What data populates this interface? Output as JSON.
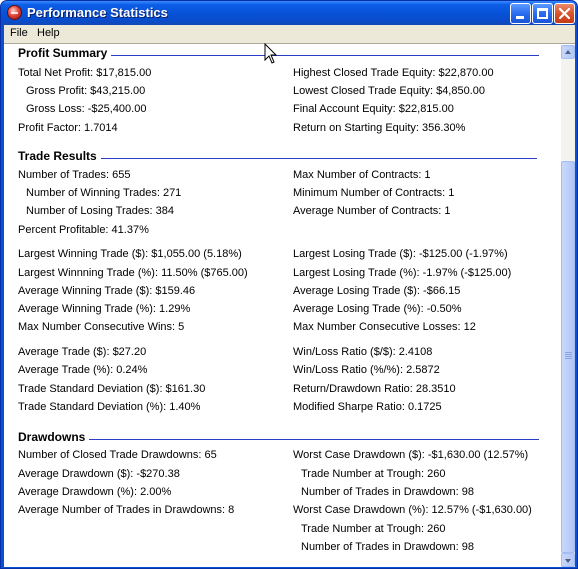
{
  "window": {
    "title": "Performance Statistics"
  },
  "menu": {
    "file": "File",
    "help": "Help"
  },
  "profit_summary": {
    "heading": "Profit Summary",
    "left": [
      "Total Net Profit: $17,815.00",
      "Gross Profit: $43,215.00",
      "Gross Loss: -$25,400.00",
      "Profit Factor: 1.7014"
    ],
    "right": [
      "Highest Closed Trade Equity: $22,870.00",
      "Lowest Closed Trade Equity: $4,850.00",
      "Final Account Equity: $22,815.00",
      "Return on Starting Equity: 356.30%"
    ]
  },
  "trade_results": {
    "heading": "Trade Results",
    "left": [
      "Number of Trades: 655",
      "Number of Winning Trades: 271",
      "Number of Losing Trades: 384",
      "Percent Profitable: 41.37%",
      "Largest Winning Trade ($): $1,055.00  (5.18%)",
      "Largest Winnning Trade (%): 11.50%  ($765.00)",
      "Average Winning Trade ($): $159.46",
      "Average Winning Trade (%): 1.29%",
      "Max Number Consecutive Wins: 5",
      "Average Trade ($): $27.20",
      "Average Trade (%): 0.24%",
      "Trade Standard Deviation ($): $161.30",
      "Trade Standard Deviation (%): 1.40%"
    ],
    "right": [
      "Max Number of Contracts: 1",
      "Minimum Number of Contracts: 1",
      "Average Number of Contracts: 1",
      "Largest Losing Trade ($): -$125.00  (-1.97%)",
      "Largest Losing Trade (%): -1.97%  (-$125.00)",
      "Average Losing Trade ($): -$66.15",
      "Average Losing Trade (%): -0.50%",
      "Max Number Consecutive Losses: 12",
      "Win/Loss Ratio ($/$): 2.4108",
      "Win/Loss Ratio (%/%): 2.5872",
      "Return/Drawdown Ratio: 28.3510",
      "Modified Sharpe Ratio: 0.1725"
    ]
  },
  "drawdowns": {
    "heading": "Drawdowns",
    "left": [
      "Number of Closed Trade Drawdowns: 65",
      "Average Drawdown ($): -$270.38",
      "Average Drawdown (%): 2.00%",
      "Average Number of Trades in Drawdowns: 8"
    ],
    "right": [
      "Worst Case Drawdown ($): -$1,630.00  (12.57%)",
      "Trade Number at Trough: 260",
      "Number of Trades in Drawdown: 98",
      "Worst Case Drawdown (%): 12.57%  (-$1,630.00)",
      "Trade Number at Trough: 260",
      "Number of Trades in Drawdown: 98"
    ]
  },
  "colors": {
    "titlebar": "#0a4fd4",
    "section_rule": "#2a3fc8",
    "menubar": "#ece9d8"
  },
  "icons": [
    "app-icon",
    "minimize-icon",
    "maximize-icon",
    "close-icon",
    "scroll-up-arrow-icon",
    "scroll-down-arrow-icon",
    "mouse-cursor-icon"
  ]
}
